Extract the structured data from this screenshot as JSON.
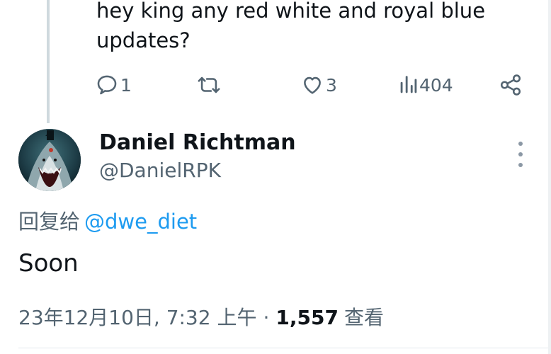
{
  "parent_tweet": {
    "text": "hey king  any red white and royal blue updates?",
    "actions": {
      "reply_count": "1",
      "retweet_count": "",
      "like_count": "3",
      "view_count": "404"
    }
  },
  "reply_tweet": {
    "author_name": "Daniel Richtman",
    "author_handle": "@DanielRPK",
    "reply_prefix": "回复给",
    "reply_mention": "@dwe_diet",
    "text": "Soon",
    "timestamp": "23年12月10日, 7:32 上午",
    "separator": "·",
    "views_number": "1,557",
    "views_label": "查看"
  },
  "icons": {
    "reply": "reply-bubble-icon",
    "retweet": "retweet-icon",
    "like": "heart-icon",
    "views": "bar-chart-icon",
    "share": "share-icon",
    "more": "more-vertical-icon"
  },
  "colors": {
    "text": "#0f1419",
    "secondary": "#536471",
    "link": "#1d9bf0",
    "thread_line": "#cfd9de"
  }
}
